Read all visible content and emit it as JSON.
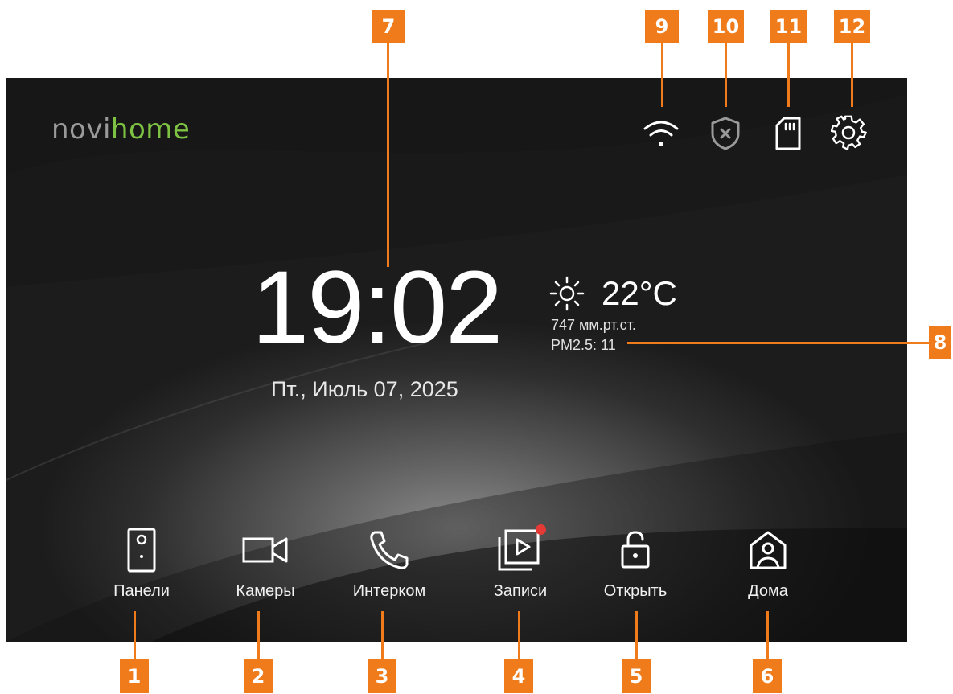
{
  "brand": {
    "logo_part1": "novi",
    "logo_part2": "home",
    "accent": "#7dc242"
  },
  "status_bar": [
    {
      "icon": "wifi-icon"
    },
    {
      "icon": "shield-x-icon"
    },
    {
      "icon": "sd-card-icon"
    },
    {
      "icon": "gear-icon"
    }
  ],
  "clock": {
    "time": "19:02",
    "date": "Пт., Июль 07, 2025"
  },
  "weather": {
    "icon": "sun-icon",
    "temperature": "22°C",
    "pressure": "747 мм.рт.ст.",
    "pm25": "PM2.5: 11"
  },
  "nav": [
    {
      "label": "Панели",
      "icon": "panel-icon"
    },
    {
      "label": "Камеры",
      "icon": "camera-icon"
    },
    {
      "label": "Интерком",
      "icon": "phone-icon"
    },
    {
      "label": "Записи",
      "icon": "recordings-icon",
      "badge": true
    },
    {
      "label": "Открыть",
      "icon": "unlock-icon"
    },
    {
      "label": "Дома",
      "icon": "home-user-icon"
    }
  ],
  "callouts": [
    "1",
    "2",
    "3",
    "4",
    "5",
    "6",
    "7",
    "8",
    "9",
    "10",
    "11",
    "12"
  ],
  "colors": {
    "callout": "#f07b1a",
    "badge": "#e53935"
  }
}
